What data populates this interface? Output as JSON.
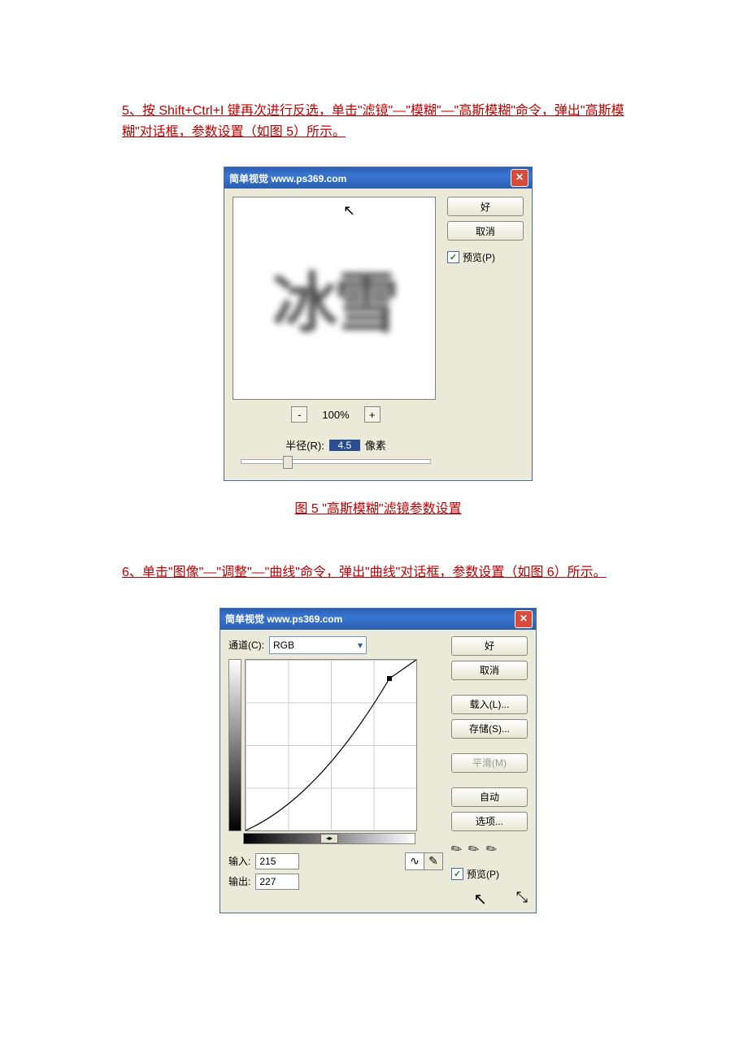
{
  "step5": {
    "text": "5、按 Shift+Ctrl+I 键再次进行反选，单击\"滤镜\"—\"模糊\"—\"高斯模糊\"命令，弹出\"高斯模糊\"对话框，参数设置（如图 5）所示。"
  },
  "step6": {
    "text": "6、单击\"图像\"—\"调整\"—\"曲线\"命令，弹出\"曲线\"对话框，参数设置（如图 6）所示。"
  },
  "caption5": "图 5 \"高斯模糊\"滤镜参数设置",
  "gaussian": {
    "titlebar": "简单视觉 www.ps369.com",
    "ok": "好",
    "cancel": "取消",
    "preview_label": "预览(P)",
    "zoom_pct": "100%",
    "radius_label": "半径(R):",
    "radius_value": "4.5",
    "pixel_label": "像素",
    "sample_text": "冰雪"
  },
  "curves": {
    "titlebar": "简单视觉 www.ps369.com",
    "channel_label": "通道(C):",
    "channel_value": "RGB",
    "ok": "好",
    "cancel": "取消",
    "load": "载入(L)...",
    "save": "存储(S)...",
    "smooth": "平滑(M)",
    "auto": "自动",
    "options": "选项...",
    "preview_label": "预览(P)",
    "input_label": "输入:",
    "input_value": "215",
    "output_label": "输出:",
    "output_value": "227"
  },
  "chart_data": {
    "type": "line",
    "title": "Curves",
    "xlabel": "Input",
    "ylabel": "Output",
    "xlim": [
      0,
      255
    ],
    "ylim": [
      0,
      255
    ],
    "series": [
      {
        "name": "RGB curve",
        "x": [
          0,
          110,
          215,
          255
        ],
        "y": [
          0,
          80,
          227,
          255
        ]
      }
    ],
    "annotations": [
      {
        "x": 215,
        "y": 227,
        "label": "control point"
      }
    ]
  }
}
